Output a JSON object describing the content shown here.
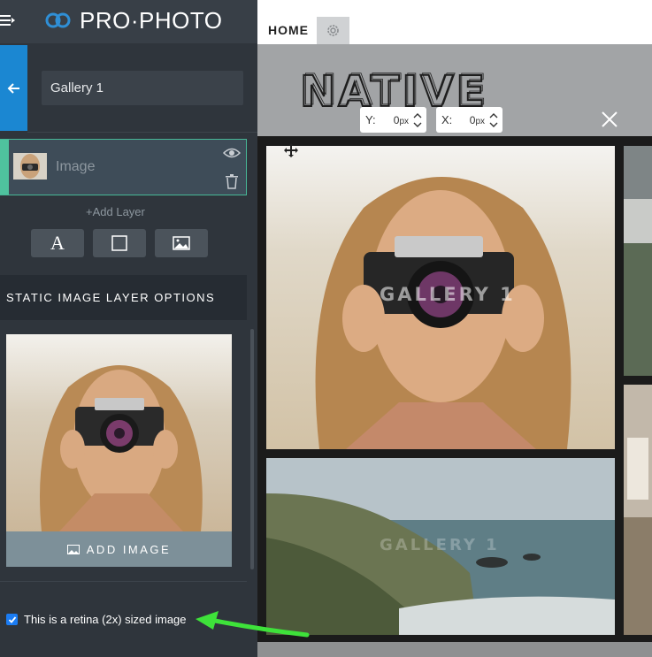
{
  "app": {
    "brand": "PRO·PHOTO",
    "brand_color": "#ffffff",
    "accent": "#1b87d2",
    "layer_accent": "#4fc29e"
  },
  "sidebar": {
    "gallery_name": "Gallery 1",
    "layer": {
      "label": "Image",
      "icons": [
        "eye-icon",
        "trash-icon"
      ]
    },
    "add_layer_label": "+Add Layer",
    "layer_tools": [
      {
        "name": "text-layer",
        "glyph": "A"
      },
      {
        "name": "rectangle-layer",
        "glyph": "square"
      },
      {
        "name": "image-layer",
        "glyph": "image"
      }
    ],
    "options_header": "STATIC IMAGE LAYER OPTIONS",
    "add_image_label": "ADD IMAGE",
    "retina_label": "This is a retina (2x) sized image",
    "retina_checked": true
  },
  "canvas": {
    "home_tab": "HOME",
    "logo_text": "NATIVE",
    "coords": {
      "y_label": "Y:",
      "y_value": "0",
      "y_unit": "px",
      "x_label": "X:",
      "x_value": "0",
      "x_unit": "px"
    },
    "watermark_main": "GALLERY 1",
    "watermark_sea": "GALLERY 1"
  }
}
